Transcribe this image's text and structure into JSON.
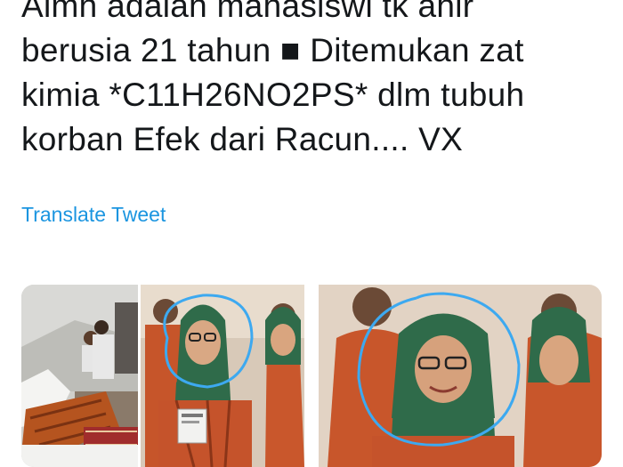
{
  "tweet": {
    "text_lines": [
      "Almh adalah mahasiswi tk ahir",
      "berusia 21 tahun ■ Ditemukan zat",
      "kimia *C11H26NO2PS* dlm tubuh",
      "korban Efek dari Racun.... VX"
    ],
    "translate_label": "Translate Tweet"
  },
  "media": {
    "photos": [
      {
        "name": "funeral-photo",
        "description_icon": "photo"
      },
      {
        "name": "woman-hijab-photo",
        "description_icon": "photo"
      },
      {
        "name": "woman-hijab-zoom-photo",
        "description_icon": "photo"
      }
    ]
  },
  "colors": {
    "link": "#1b95e0",
    "text": "#14171a",
    "circle": "#3da9f0",
    "batik_orange": "#d2552b",
    "hijab_green": "#2f6b4a"
  }
}
